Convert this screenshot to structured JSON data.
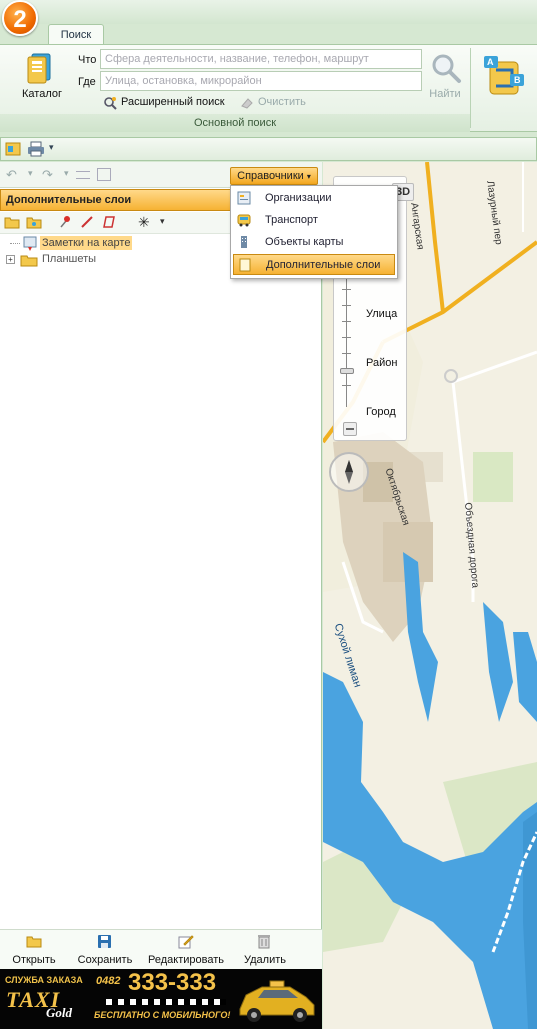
{
  "app": {
    "logo_text": "2"
  },
  "tabs": [
    {
      "label": "Поиск"
    }
  ],
  "ribbon": {
    "catalog_label": "Каталог",
    "what_label": "Что",
    "where_label": "Где",
    "what_placeholder": "Сфера деятельности, название, телефон, маршрут",
    "where_placeholder": "Улица, остановка, микрорайон",
    "find_label": "Найти",
    "advanced_label": "Расширенный поиск",
    "clear_label": "Очистить",
    "group_label": "Основной поиск",
    "route_a": "A",
    "route_b": "B"
  },
  "panel": {
    "directories_button": "Справочники",
    "header": "Дополнительные слои",
    "tree": [
      {
        "label": "Заметки на карте",
        "selected": true
      },
      {
        "label": "Планшеты",
        "selected": false
      }
    ]
  },
  "dropdown": {
    "items": [
      {
        "label": "Организации",
        "icon": "organizations-icon"
      },
      {
        "label": "Транспорт",
        "icon": "transport-icon"
      },
      {
        "label": "Объекты карты",
        "icon": "map-objects-icon"
      },
      {
        "label": "Дополнительные слои",
        "icon": "layers-icon",
        "selected": true
      }
    ]
  },
  "map": {
    "mode_3d": "3D",
    "zoom_levels": [
      "Улица",
      "Район",
      "Город"
    ],
    "streets": [
      "Ангарская",
      "Лазурный пер",
      "Октябрьская",
      "Объездная дорога",
      "Сухой лиман"
    ]
  },
  "bottom_actions": {
    "open": "Открыть",
    "save": "Сохранить",
    "edit": "Редактировать",
    "delete": "Удалить"
  },
  "ad": {
    "service_label": "СЛУЖБА ЗАКАЗА",
    "brand_taxi": "TAXI",
    "brand_gold": "Gold",
    "code": "0482",
    "number": "333-333",
    "subtitle": "БЕСПЛАТНО С МОБИЛЬНОГО!"
  },
  "colors": {
    "accent": "#f6b233",
    "ribbon": "#e5f0e3",
    "water": "#4aa3e0",
    "road": "#f0b020"
  }
}
